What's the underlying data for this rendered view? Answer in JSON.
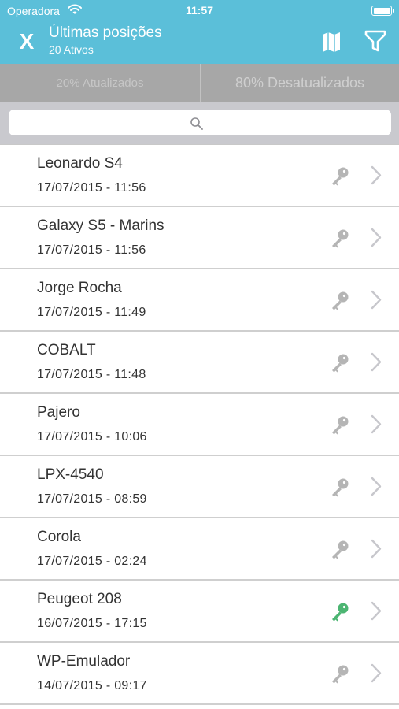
{
  "status_bar": {
    "carrier": "Operadora",
    "time": "11:57"
  },
  "nav": {
    "close_label": "X",
    "title": "Últimas posições",
    "subtitle": "20 Ativos"
  },
  "segments": [
    {
      "label": "20% Atualizados"
    },
    {
      "label": "80% Desatualizados"
    }
  ],
  "search": {
    "value": "",
    "placeholder": ""
  },
  "colors": {
    "header": "#5bbfd9",
    "key_inactive": "#b5b5b5",
    "key_active": "#4cb572"
  },
  "devices": [
    {
      "name": "Leonardo S4",
      "datetime": "17/07/2015 - 11:56",
      "key_status": "inactive"
    },
    {
      "name": "Galaxy S5 - Marins",
      "datetime": "17/07/2015 - 11:56",
      "key_status": "inactive"
    },
    {
      "name": "Jorge Rocha",
      "datetime": "17/07/2015 - 11:49",
      "key_status": "inactive"
    },
    {
      "name": "COBALT",
      "datetime": "17/07/2015 - 11:48",
      "key_status": "inactive"
    },
    {
      "name": "Pajero",
      "datetime": "17/07/2015 - 10:06",
      "key_status": "inactive"
    },
    {
      "name": "LPX-4540",
      "datetime": "17/07/2015 - 08:59",
      "key_status": "inactive"
    },
    {
      "name": "Corola",
      "datetime": "17/07/2015 - 02:24",
      "key_status": "inactive"
    },
    {
      "name": "Peugeot 208",
      "datetime": "16/07/2015 - 17:15",
      "key_status": "active"
    },
    {
      "name": "WP-Emulador",
      "datetime": "14/07/2015 - 09:17",
      "key_status": "inactive"
    }
  ]
}
